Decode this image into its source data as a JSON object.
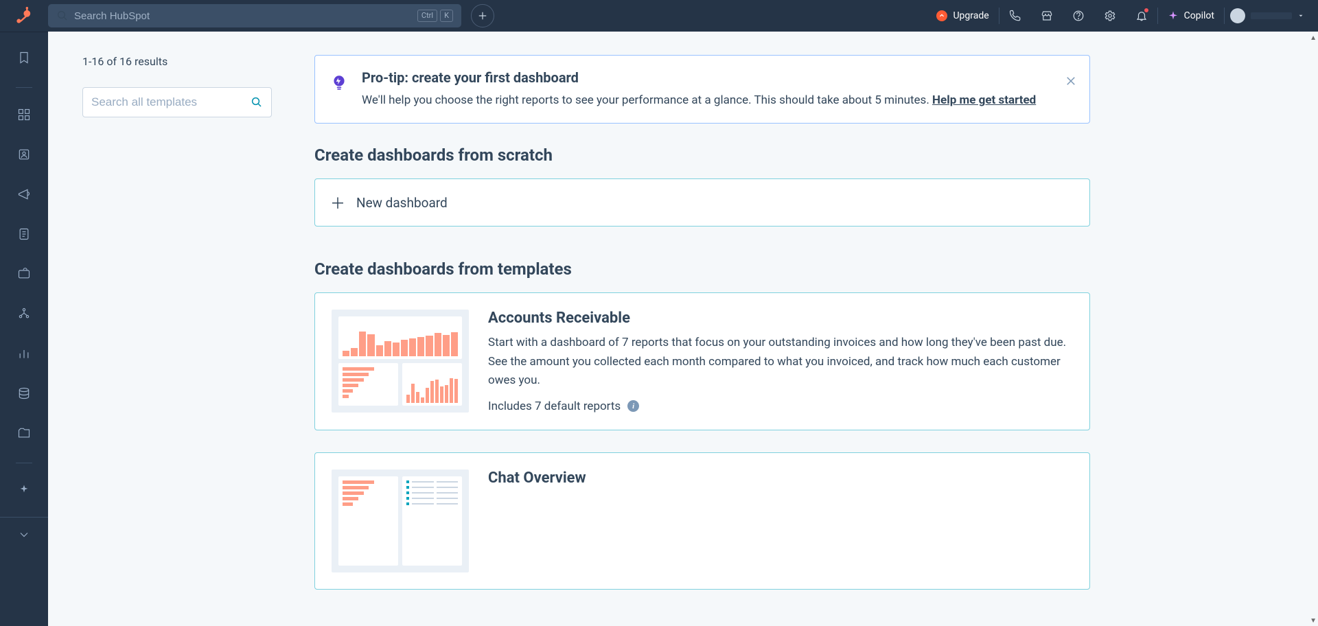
{
  "top": {
    "search_placeholder": "Search HubSpot",
    "kbd1": "Ctrl",
    "kbd2": "K",
    "upgrade": "Upgrade",
    "copilot": "Copilot"
  },
  "left": {
    "results": "1-16 of 16 results",
    "template_search_placeholder": "Search all templates"
  },
  "tip": {
    "title": "Pro-tip: create your first dashboard",
    "body_a": "We'll help you choose the right reports to see your performance at a glance. This should take about 5 minutes. ",
    "link": "Help me get started"
  },
  "sections": {
    "scratch": "Create dashboards from scratch",
    "templates": "Create dashboards from templates",
    "new_dash": "New dashboard"
  },
  "templates": [
    {
      "title": "Accounts Receivable",
      "desc": "Start with a dashboard of 7 reports that focus on your outstanding invoices and how long they've been past due. See the amount you collected each month compared to what you invoiced, and track how much each customer owes you.",
      "includes": "Includes 7 default reports"
    },
    {
      "title": "Chat Overview",
      "desc": "",
      "includes": ""
    }
  ]
}
